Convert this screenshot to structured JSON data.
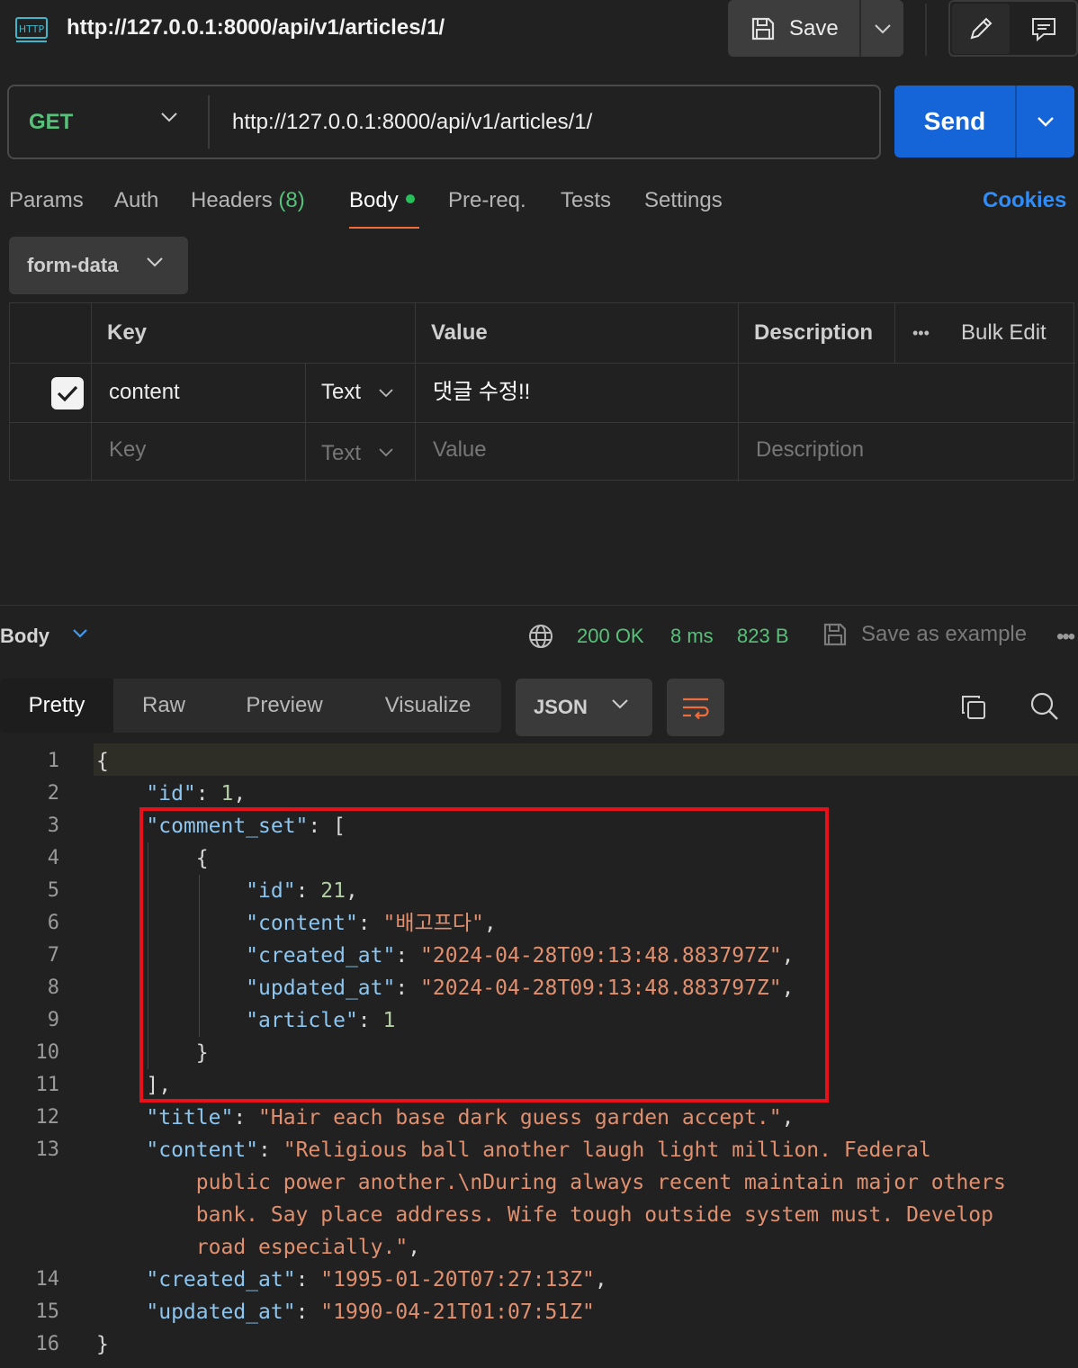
{
  "top": {
    "url_title": "http://127.0.0.1:8000/api/v1/articles/1/",
    "save_label": "Save"
  },
  "request": {
    "method": "GET",
    "url": "http://127.0.0.1:8000/api/v1/articles/1/",
    "send_label": "Send"
  },
  "tabs": {
    "params": "Params",
    "auth": "Auth",
    "headers": "Headers",
    "headers_count": "(8)",
    "body": "Body",
    "prereq": "Pre-req.",
    "tests": "Tests",
    "settings": "Settings",
    "cookies": "Cookies"
  },
  "body_type": "form-data",
  "table": {
    "headers": {
      "key": "Key",
      "value": "Value",
      "description": "Description",
      "bulk_edit": "Bulk Edit",
      "more": "•••"
    },
    "rows": [
      {
        "key": "content",
        "type": "Text",
        "value": "댓글 수정!!",
        "description": "",
        "checked": true
      }
    ],
    "placeholder": {
      "key": "Key",
      "type": "Text",
      "value": "Value",
      "description": "Description"
    }
  },
  "response": {
    "body_label": "Body",
    "status": "200 OK",
    "time": "8 ms",
    "size": "823 B",
    "save_example": "Save as example",
    "more": "•••",
    "view_tabs": [
      "Pretty",
      "Raw",
      "Preview",
      "Visualize"
    ],
    "format": "JSON"
  },
  "code": {
    "line_numbers": [
      "1",
      "2",
      "3",
      "4",
      "5",
      "6",
      "7",
      "8",
      "9",
      "10",
      "11",
      "12",
      "13",
      "14",
      "15",
      "16"
    ],
    "id_key": "\"id\"",
    "id_val": "1",
    "comment_set_key": "\"comment_set\"",
    "c_id_val": "21",
    "c_content_key": "\"content\"",
    "c_content_val": "\"배고프다\"",
    "c_created_key": "\"created_at\"",
    "c_created_val": "\"2024-04-28T09:13:48.883797Z\"",
    "c_updated_key": "\"updated_at\"",
    "c_updated_val": "\"2024-04-28T09:13:48.883797Z\"",
    "c_article_key": "\"article\"",
    "c_article_val": "1",
    "title_key": "\"title\"",
    "title_val": "\"Hair each base dark guess garden accept.\"",
    "content_key": "\"content\"",
    "content_line1": "\"Religious ball another laugh light million. Federal",
    "content_line2": "public power another.\\nDuring always recent maintain major others",
    "content_line3": "bank. Say place address. Wife tough outside system must. Develop",
    "content_line4": "road especially.\"",
    "created_key": "\"created_at\"",
    "created_val": "\"1995-01-20T07:27:13Z\"",
    "updated_key": "\"updated_at\"",
    "updated_val": "\"1990-04-21T01:07:51Z\""
  },
  "colors": {
    "accent_send": "#1565d8",
    "method_get": "#57c17a",
    "status_ok": "#57c17a",
    "tab_underline": "#f26b3a",
    "cookies": "#2f8dfa",
    "highlight_box": "#e8101a"
  }
}
